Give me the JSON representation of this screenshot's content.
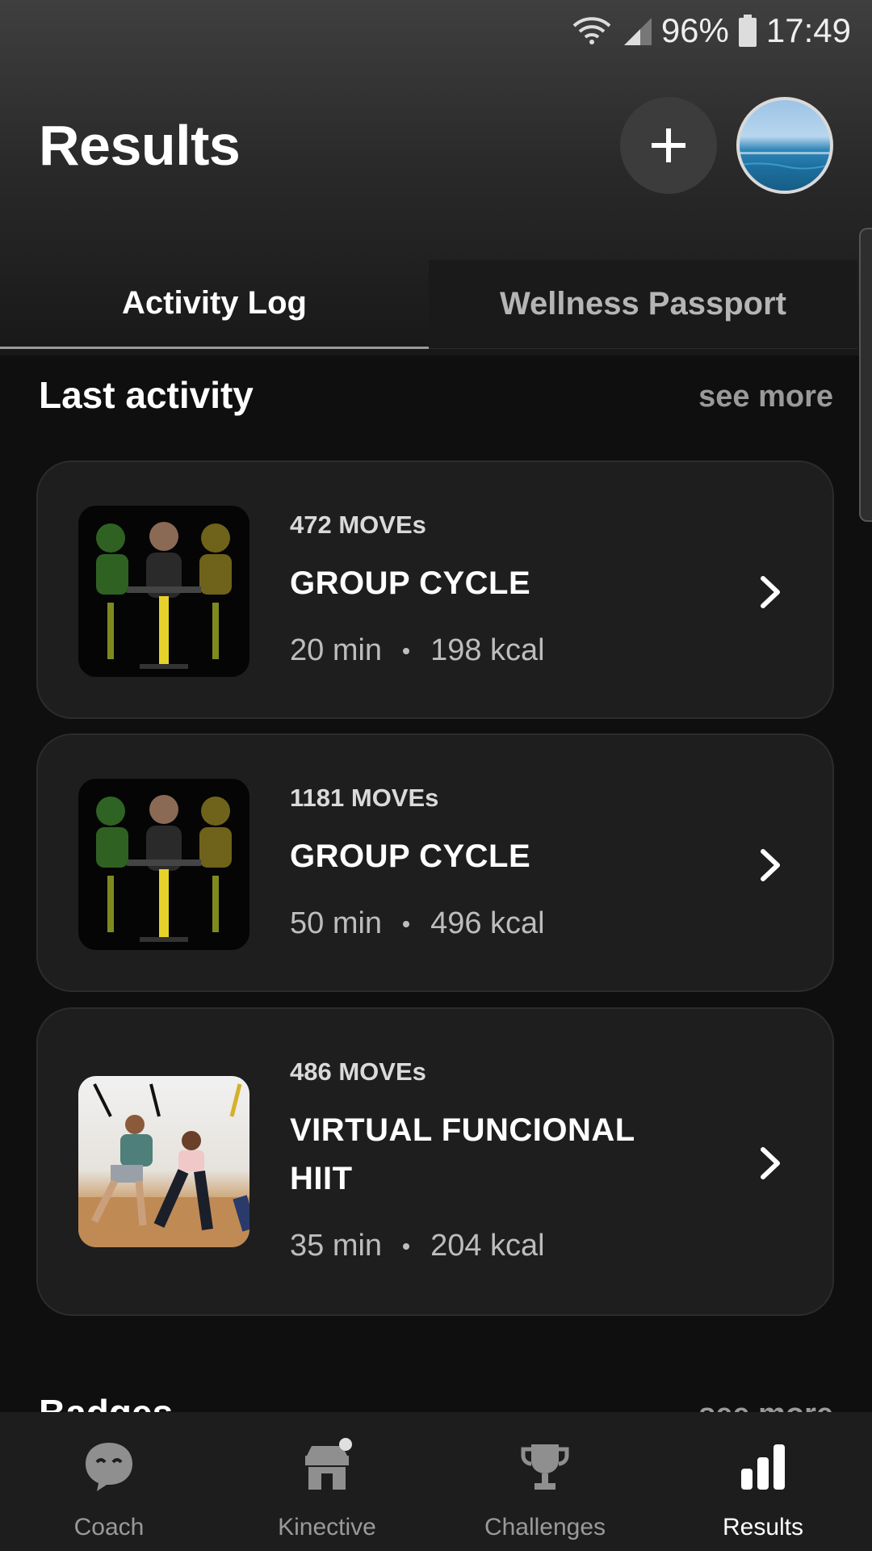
{
  "status_bar": {
    "battery": "96%",
    "time": "17:49"
  },
  "header": {
    "title": "Results"
  },
  "tabs": [
    {
      "label": "Activity Log",
      "active": true
    },
    {
      "label": "Wellness Passport",
      "active": false
    }
  ],
  "last_activity": {
    "title": "Last activity",
    "see_more": "see more",
    "items": [
      {
        "moves": "472 MOVEs",
        "name": "GROUP CYCLE",
        "duration": "20 min",
        "kcal": "198 kcal"
      },
      {
        "moves": "1181 MOVEs",
        "name": "GROUP CYCLE",
        "duration": "50 min",
        "kcal": "496 kcal"
      },
      {
        "moves": "486 MOVEs",
        "name": "VIRTUAL FUNCIONAL HIIT",
        "duration": "35 min",
        "kcal": "204 kcal"
      }
    ]
  },
  "badges": {
    "title": "Badges",
    "see_more": "see more"
  },
  "bottom_nav": [
    {
      "label": "Coach",
      "icon": "chat-face-icon"
    },
    {
      "label": "Kinective",
      "icon": "store-icon"
    },
    {
      "label": "Challenges",
      "icon": "trophy-icon"
    },
    {
      "label": "Results",
      "icon": "bar-chart-icon",
      "active": true
    }
  ]
}
